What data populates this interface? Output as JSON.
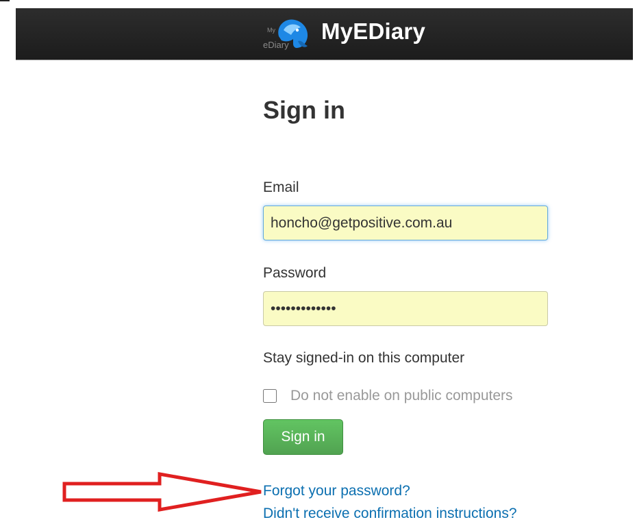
{
  "header": {
    "app_name": "MyEDiary",
    "logo_small_text_top": "My",
    "logo_small_text_bottom": "eDiary",
    "logo_icon": "elephant-logo-icon",
    "background": "#222222",
    "logo_color": "#1e88e5"
  },
  "form": {
    "title": "Sign in",
    "email_label": "Email",
    "email_value": "honcho@getpositive.com.au",
    "password_label": "Password",
    "password_value": "•••••••••••••",
    "stay_signed_in_label": "Stay signed-in on this computer",
    "remember_checkbox_label": "Do not enable on public computers",
    "remember_checked": false,
    "submit_label": "Sign in",
    "submit_color": "#5bb75b",
    "input_autofill_color": "#fafbc4"
  },
  "links": {
    "forgot_password": "Forgot your password?",
    "confirmation": "Didn't receive confirmation instructions?",
    "link_color": "#0b6fb0"
  },
  "annotation": {
    "arrow_icon": "red-arrow-icon",
    "arrow_color": "#e02020"
  }
}
